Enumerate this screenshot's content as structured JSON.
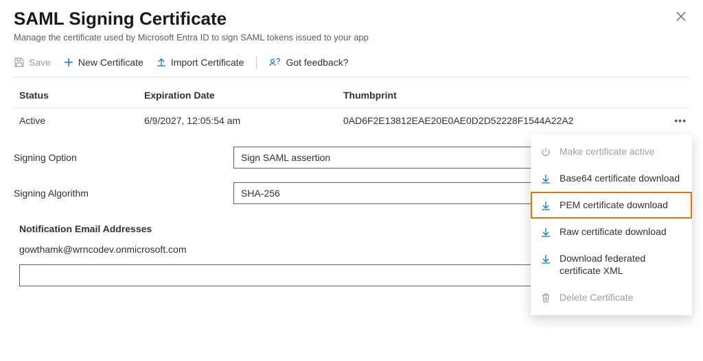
{
  "header": {
    "title": "SAML Signing Certificate",
    "subtitle": "Manage the certificate used by Microsoft Entra ID to sign SAML tokens issued to your app"
  },
  "toolbar": {
    "save": "Save",
    "new_cert": "New Certificate",
    "import_cert": "Import Certificate",
    "feedback": "Got feedback?"
  },
  "table": {
    "head": {
      "status": "Status",
      "expiration": "Expiration Date",
      "thumbprint": "Thumbprint"
    },
    "rows": [
      {
        "status": "Active",
        "expiration": "6/9/2027, 12:05:54 am",
        "thumbprint": "0AD6F2E13812EAE20E0AE0D2D52228F1544A22A2"
      }
    ]
  },
  "form": {
    "signing_option_label": "Signing Option",
    "signing_option_value": "Sign SAML assertion",
    "signing_algorithm_label": "Signing Algorithm",
    "signing_algorithm_value": "SHA-256"
  },
  "emails": {
    "section_label": "Notification Email Addresses",
    "items": [
      "gowthamk@wrncodev.onmicrosoft.com"
    ],
    "input_value": ""
  },
  "menu": {
    "make_active": "Make certificate active",
    "base64": "Base64 certificate download",
    "pem": "PEM certificate download",
    "raw": "Raw certificate download",
    "federated": "Download federated certificate XML",
    "delete": "Delete Certificate"
  }
}
